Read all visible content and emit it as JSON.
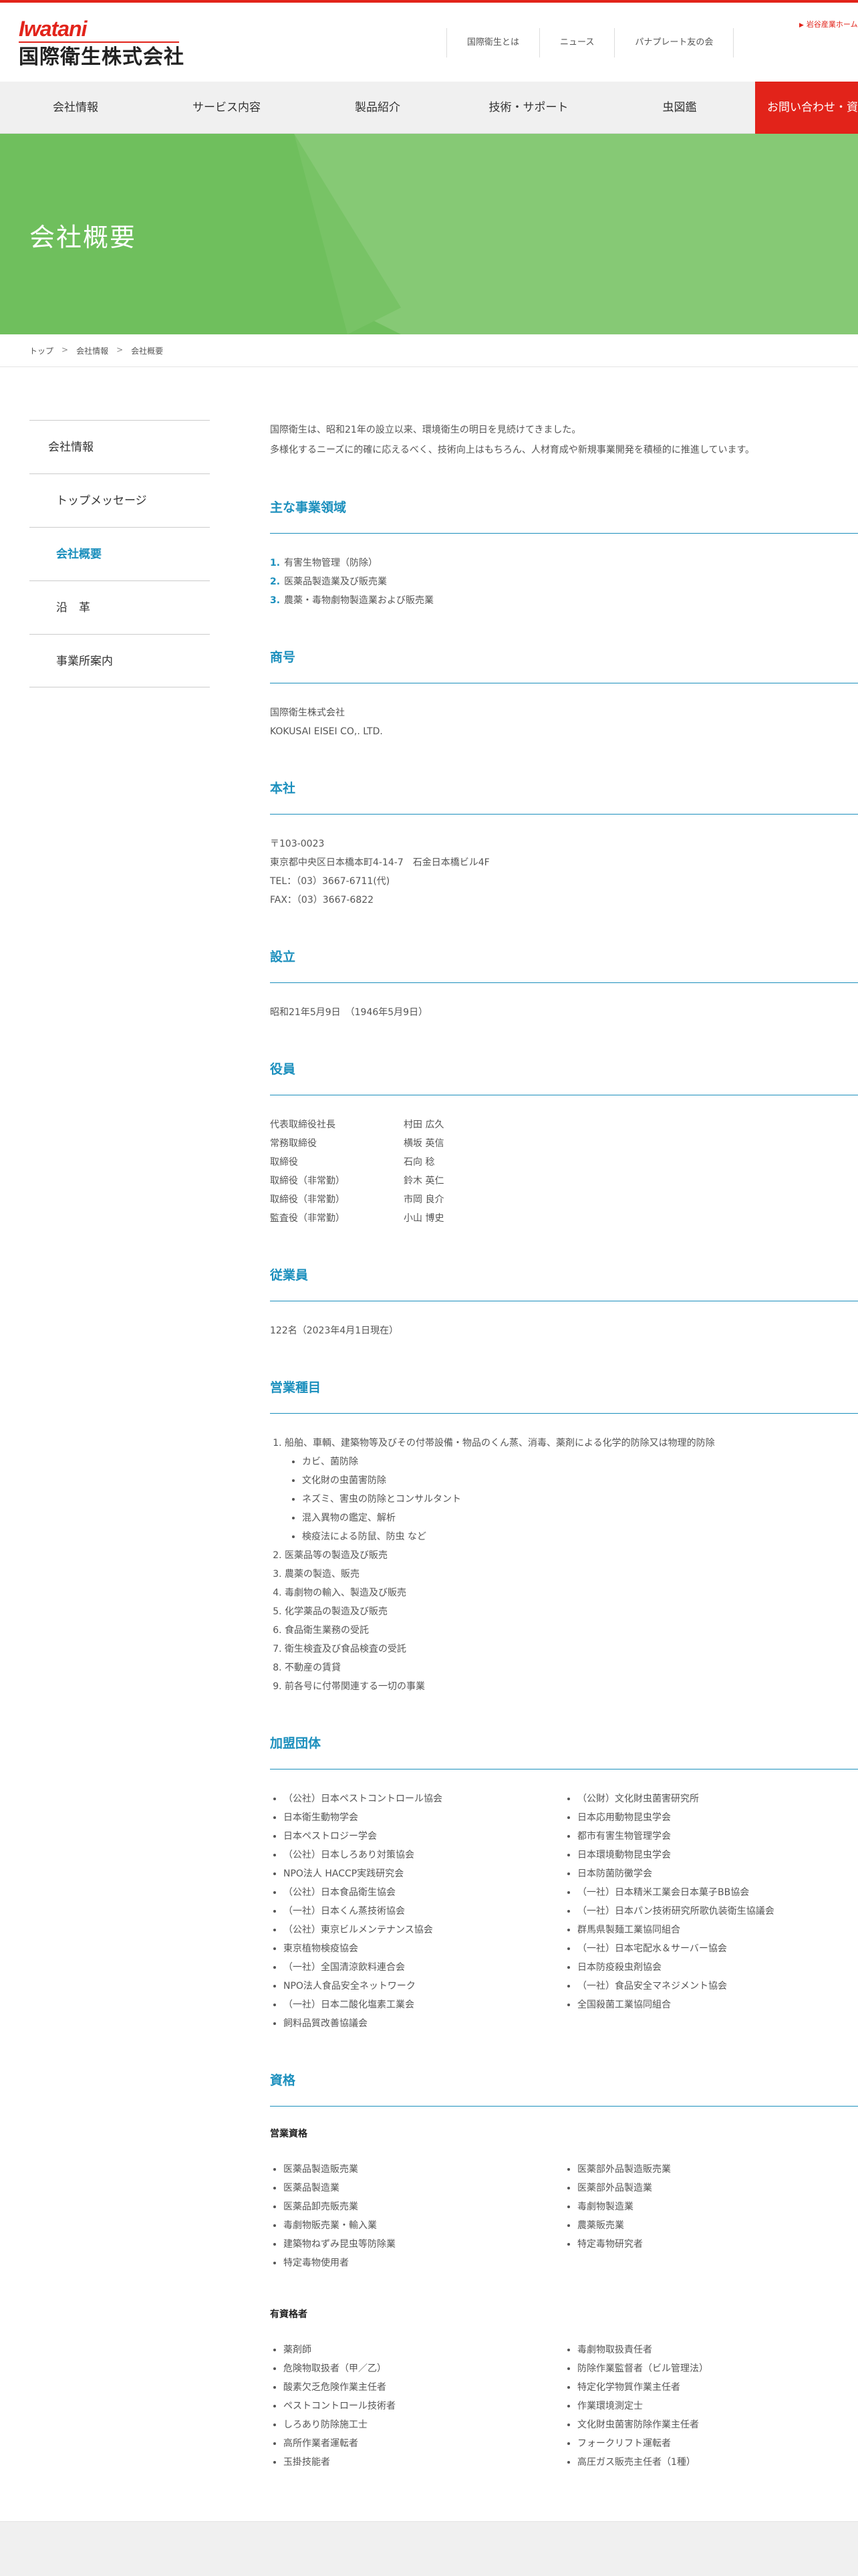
{
  "header": {
    "logo_en": "Iwatani",
    "logo_ja": "国際衛生株式会社",
    "top_links": [
      "国際衛生とは",
      "ニュース",
      "パナプレート友の会"
    ],
    "corporate_link": "岩谷産業ホーム"
  },
  "gnav": {
    "items": [
      "会社情報",
      "サービス内容",
      "製品紹介",
      "技術・サポート",
      "虫図鑑"
    ],
    "contact": "お問い合わせ・資料"
  },
  "hero": {
    "title": "会社概要"
  },
  "breadcrumb": [
    "トップ",
    "会社情報",
    "会社概要"
  ],
  "sidenav": {
    "parent": "会社情報",
    "items": [
      "トップメッセージ",
      "会社概要",
      "沿　革",
      "事業所案内"
    ],
    "active_index": 1
  },
  "intro": [
    "国際衛生は、昭和21年の設立以来、環境衛生の明日を見続けてきました。",
    "多様化するニーズに的確に応えるべく、技術向上はもちろん、人材育成や新規事業開発を積極的に推進しています。"
  ],
  "sections": {
    "business": {
      "title": "主な事業領域",
      "items": [
        {
          "n": "1.",
          "text": "有害生物管理（防除）"
        },
        {
          "n": "2.",
          "text": "医薬品製造業及び販売業"
        },
        {
          "n": "3.",
          "text": "農薬・毒物劇物製造業および販売業"
        }
      ]
    },
    "name": {
      "title": "商号",
      "lines": [
        "国際衛生株式会社",
        "KOKUSAI EISEI CO,. LTD."
      ]
    },
    "hq": {
      "title": "本社",
      "lines": [
        "〒103-0023",
        "東京都中央区日本橋本町4-14-7　石金日本橋ビル4F",
        "TEL：（03）3667-6711(代)",
        "FAX：（03）3667-6822"
      ]
    },
    "founded": {
      "title": "設立",
      "text": "昭和21年5月9日　（1946年5月9日）"
    },
    "officers": {
      "title": "役員",
      "rows": [
        {
          "role": "代表取締役社長",
          "name": "村田 広久"
        },
        {
          "role": "常務取締役",
          "name": "横坂 英信"
        },
        {
          "role": "取締役",
          "name": "石向 稔"
        },
        {
          "role": "取締役（非常勤）",
          "name": "鈴木 英仁"
        },
        {
          "role": "取締役（非常勤）",
          "name": "市岡 良介"
        },
        {
          "role": "監査役（非常勤）",
          "name": "小山 博史"
        }
      ]
    },
    "employees": {
      "title": "従業員",
      "text": "122名（2023年4月1日現在）"
    },
    "lines_of_business": {
      "title": "営業種目",
      "first": "船舶、車輌、建築物等及びその付帯設備・物品のくん蒸、消毒、薬剤による化学的防除又は物理的防除",
      "sub": [
        "カビ、菌防除",
        "文化財の虫菌害防除",
        "ネズミ、害虫の防除とコンサルタント",
        "混入異物の鑑定、解析",
        "検疫法による防鼠、防虫 など"
      ],
      "rest": [
        "医薬品等の製造及び販売",
        "農薬の製造、販売",
        "毒劇物の輸入、製造及び販売",
        "化学薬品の製造及び販売",
        "食品衛生業務の受託",
        "衛生検査及び食品検査の受託",
        "不動産の賃貸",
        "前各号に付帯関連する一切の事業"
      ]
    },
    "memberships": {
      "title": "加盟団体",
      "left": [
        "（公社）日本ペストコントロール協会",
        "日本衛生動物学会",
        "日本ペストロジー学会",
        "（公社）日本しろあり対策協会",
        "NPO法人 HACCP実践研究会",
        "（公社）日本食品衛生協会",
        "（一社）日本くん蒸技術協会",
        "（公社）東京ビルメンテナンス協会",
        "東京植物検疫協会",
        "（一社）全国清涼飲料連合会",
        "NPO法人食品安全ネットワーク",
        "（一社）日本二酸化塩素工業会",
        "飼料品質改善協議会"
      ],
      "right": [
        "（公財）文化財虫菌害研究所",
        "日本応用動物昆虫学会",
        "都市有害生物管理学会",
        "日本環境動物昆虫学会",
        "日本防菌防黴学会",
        "（一社）日本精米工業会日本菓子BB協会",
        "（一社）日本パン技術研究所歌仇装衛生協議会",
        "群馬県製麺工業協同組合",
        "（一社）日本宅配水＆サーバー協会",
        "日本防疫殺虫剤協会",
        "（一社）食品安全マネジメント協会",
        "全国殺菌工業協同組合"
      ]
    },
    "qualifications": {
      "title": "資格",
      "sub1": "営業資格",
      "q_left": [
        "医薬品製造販売業",
        "医薬品製造業",
        "医薬品卸売販売業",
        "毒劇物販売業・輸入業",
        "建築物ねずみ昆虫等防除業",
        "特定毒物使用者"
      ],
      "q_right": [
        "医薬部外品製造販売業",
        "医薬部外品製造業",
        "毒劇物製造業",
        "農薬販売業",
        "特定毒物研究者"
      ],
      "sub2": "有資格者",
      "h_left": [
        "薬剤師",
        "危険物取扱者（甲／乙）",
        "酸素欠乏危険作業主任者",
        "ペストコントロール技術者",
        "しろあり防除施工士",
        "高所作業者運転者",
        "玉掛技能者"
      ],
      "h_right": [
        "毒劇物取扱責任者",
        "防除作業監督者（ビル管理法）",
        "特定化学物質作業主任者",
        "作業環境測定士",
        "文化財虫菌害防除作業主任者",
        "フォークリフト運転者",
        "高圧ガス販売主任者（1種）"
      ]
    }
  },
  "colors": {
    "brand_red": "#e2231a",
    "accent_blue": "#1b8fbd",
    "hero_green": "#6fbf5d"
  }
}
